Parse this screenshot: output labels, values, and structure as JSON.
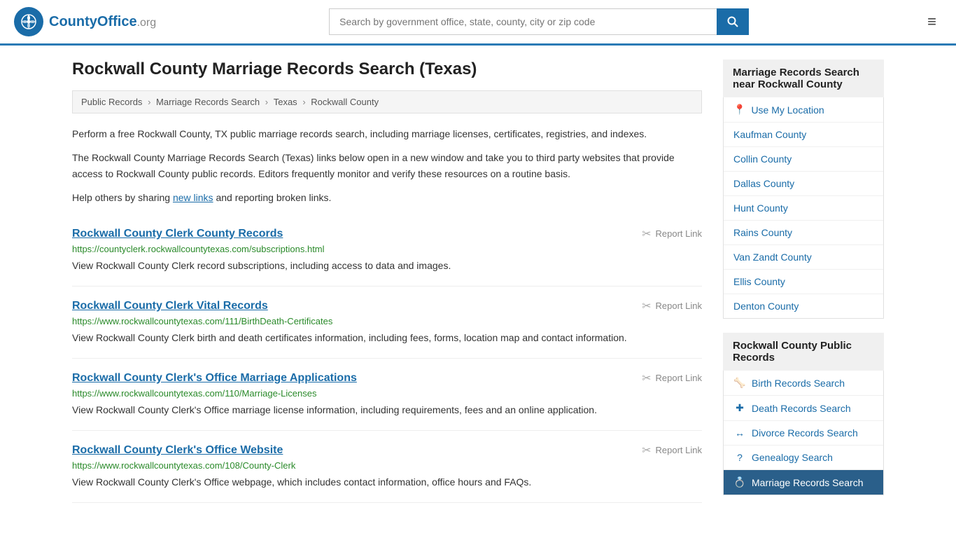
{
  "header": {
    "logo_text": "County",
    "logo_org": "Office",
    "logo_domain": ".org",
    "search_placeholder": "Search by government office, state, county, city or zip code",
    "search_value": ""
  },
  "page": {
    "title": "Rockwall County Marriage Records Search (Texas)",
    "breadcrumb": [
      {
        "label": "Public Records",
        "href": "#"
      },
      {
        "label": "Marriage Records Search",
        "href": "#"
      },
      {
        "label": "Texas",
        "href": "#"
      },
      {
        "label": "Rockwall County",
        "href": "#"
      }
    ],
    "intro1": "Perform a free Rockwall County, TX public marriage records search, including marriage licenses, certificates, registries, and indexes.",
    "intro2": "The Rockwall County Marriage Records Search (Texas) links below open in a new window and take you to third party websites that provide access to Rockwall County public records. Editors frequently monitor and verify these resources on a routine basis.",
    "intro3_pre": "Help others by sharing ",
    "intro3_link": "new links",
    "intro3_post": " and reporting broken links.",
    "results": [
      {
        "title": "Rockwall County Clerk County Records",
        "url": "https://countyclerk.rockwallcountytexas.com/subscriptions.html",
        "desc": "View Rockwall County Clerk record subscriptions, including access to data and images.",
        "report": "Report Link"
      },
      {
        "title": "Rockwall County Clerk Vital Records",
        "url": "https://www.rockwallcountytexas.com/111/BirthDeath-Certificates",
        "desc": "View Rockwall County Clerk birth and death certificates information, including fees, forms, location map and contact information.",
        "report": "Report Link"
      },
      {
        "title": "Rockwall County Clerk's Office Marriage Applications",
        "url": "https://www.rockwallcountytexas.com/110/Marriage-Licenses",
        "desc": "View Rockwall County Clerk's Office marriage license information, including requirements, fees and an online application.",
        "report": "Report Link"
      },
      {
        "title": "Rockwall County Clerk's Office Website",
        "url": "https://www.rockwallcountytexas.com/108/County-Clerk",
        "desc": "View Rockwall County Clerk's Office webpage, which includes contact information, office hours and FAQs.",
        "report": "Report Link"
      }
    ]
  },
  "sidebar": {
    "nearby_title": "Marriage Records Search near Rockwall County",
    "use_location": "Use My Location",
    "nearby_counties": [
      "Kaufman County",
      "Collin County",
      "Dallas County",
      "Hunt County",
      "Rains County",
      "Van Zandt County",
      "Ellis County",
      "Denton County"
    ],
    "public_records_title": "Rockwall County Public Records",
    "public_records": [
      {
        "icon": "🦴",
        "label": "Birth Records Search"
      },
      {
        "icon": "+",
        "label": "Death Records Search"
      },
      {
        "icon": "↔",
        "label": "Divorce Records Search"
      },
      {
        "icon": "?",
        "label": "Genealogy Search"
      },
      {
        "icon": "💍",
        "label": "Marriage Records Search"
      }
    ]
  }
}
